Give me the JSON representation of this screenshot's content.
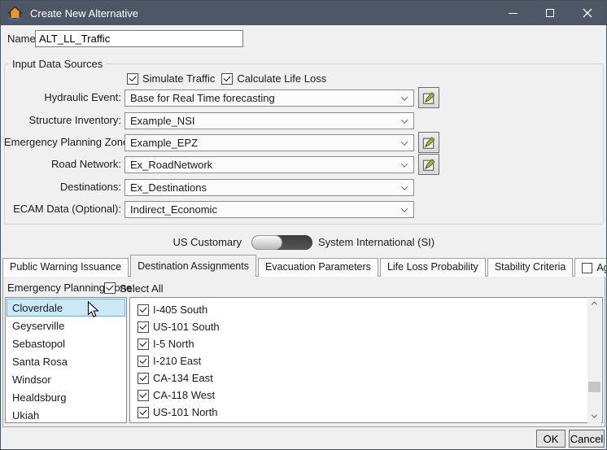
{
  "window": {
    "title": "Create New Alternative"
  },
  "name_field": {
    "label": "Name:",
    "value": "ALT_LL_Traffic"
  },
  "input_data_sources": {
    "title": "Input Data Sources",
    "checkboxes": [
      {
        "label": "Simulate Traffic",
        "checked": true
      },
      {
        "label": "Calculate Life Loss",
        "checked": true
      }
    ],
    "rows": [
      {
        "label": "Hydraulic Event:",
        "value": "Base for Real Time forecasting",
        "has_edit_button": true
      },
      {
        "label": "Structure Inventory:",
        "value": "Example_NSI",
        "has_edit_button": false
      },
      {
        "label": "Emergency Planning Zone:",
        "value": "Example_EPZ",
        "has_edit_button": true
      },
      {
        "label": "Road Network:",
        "value": "Ex_RoadNetwork",
        "has_edit_button": true
      },
      {
        "label": "Destinations:",
        "value": "Ex_Destinations",
        "has_edit_button": false
      },
      {
        "label": "ECAM Data (Optional):",
        "value": "Indirect_Economic",
        "has_edit_button": false
      }
    ]
  },
  "unit_toggle": {
    "left_label": "US Customary",
    "right_label": "System International (SI)",
    "selected": "US Customary"
  },
  "tabs": [
    {
      "label": "Public Warning Issuance",
      "active": false
    },
    {
      "label": "Destination Assignments",
      "active": true
    },
    {
      "label": "Evacuation Parameters",
      "active": false
    },
    {
      "label": "Life Loss Probability",
      "active": false
    },
    {
      "label": "Stability Criteria",
      "active": false
    },
    {
      "label": "Agriculture",
      "active": false,
      "has_checkbox": true,
      "checkbox_checked": false
    }
  ],
  "destination_assignments": {
    "epz_label": "Emergency Planning Zone:",
    "select_all": {
      "label": "Select All",
      "checked": true
    },
    "zones": [
      {
        "label": "Cloverdale",
        "selected": true
      },
      {
        "label": "Geyserville",
        "selected": false
      },
      {
        "label": "Sebastopol",
        "selected": false
      },
      {
        "label": "Santa Rosa",
        "selected": false
      },
      {
        "label": "Windsor",
        "selected": false
      },
      {
        "label": "Healdsburg",
        "selected": false
      },
      {
        "label": "Ukiah",
        "selected": false
      }
    ],
    "destinations": [
      {
        "label": "I-405 South",
        "checked": true
      },
      {
        "label": "US-101 South",
        "checked": true
      },
      {
        "label": "I-5 North",
        "checked": true
      },
      {
        "label": "I-210 East",
        "checked": true
      },
      {
        "label": "CA-134 East",
        "checked": true
      },
      {
        "label": "CA-118 West",
        "checked": true
      },
      {
        "label": "US-101 North",
        "checked": true
      }
    ]
  },
  "footer": {
    "ok_label": "OK",
    "cancel_label": "Cancel"
  },
  "colors": {
    "titlebar": "#4d5766",
    "dialog_bg": "#f0f0f0",
    "selection_bg": "#cbe8f6",
    "selection_border": "#5fb4e0",
    "toggle_track": "#464646",
    "edit_icon_green": "#9cb440"
  },
  "icons": {
    "app": "house-flood-icon",
    "window_controls": [
      "minimize-icon",
      "maximize-icon",
      "close-icon"
    ],
    "combo": "chevron-down-icon",
    "edit": "edit-pencil-icon",
    "scrollbar": [
      "chevron-up-icon",
      "chevron-down-icon"
    ],
    "pointer": "mouse-cursor-icon"
  }
}
